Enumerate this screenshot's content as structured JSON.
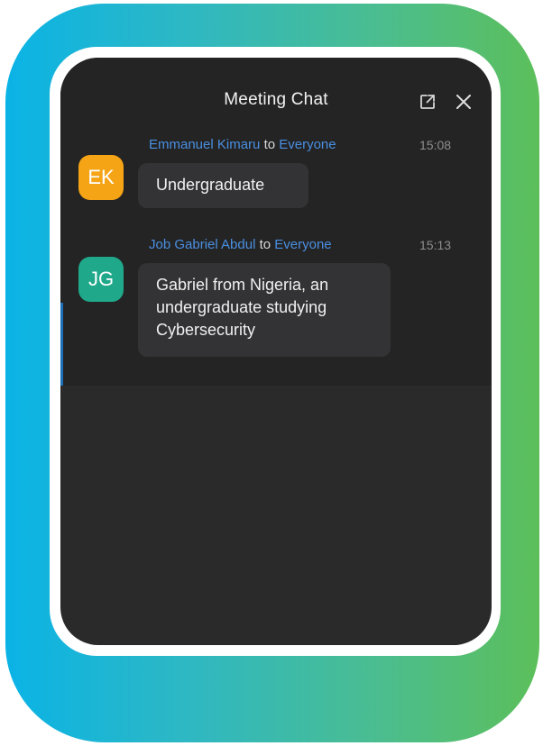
{
  "chat": {
    "title": "Meeting Chat",
    "messages": [
      {
        "sender": "Emmanuel Kimaru",
        "to_word": "to",
        "recipient": "Everyone",
        "time": "15:08",
        "initials": "EK",
        "avatar_color": "#f5a416",
        "text": "Undergraduate"
      },
      {
        "sender": "Job Gabriel Abdul",
        "to_word": "to",
        "recipient": "Everyone",
        "time": "15:13",
        "initials": "JG",
        "avatar_color": "#1fa88a",
        "text": "Gabriel from Nigeria, an undergraduate studying Cybersecurity"
      }
    ]
  },
  "colors": {
    "gradient_start": "#0ab3e6",
    "gradient_end": "#5cbf5a",
    "chat_background": "#242425",
    "name_link": "#4a8fe0"
  },
  "icons": {
    "popout": "popout-icon",
    "close": "close-icon"
  }
}
